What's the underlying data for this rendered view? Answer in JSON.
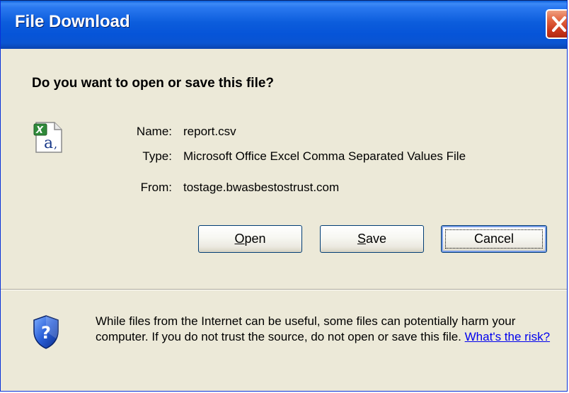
{
  "window": {
    "title": "File Download"
  },
  "dialog": {
    "question": "Do you want to open or save this file?",
    "file": {
      "name_label": "Name:",
      "name_value": "report.csv",
      "type_label": "Type:",
      "type_value": "Microsoft Office Excel Comma Separated Values File",
      "from_label": "From:",
      "from_value": "tostage.bwasbestostrust.com",
      "icon": "excel-csv-file-icon"
    },
    "buttons": {
      "open_mnemonic": "O",
      "open_rest": "pen",
      "save_mnemonic": "S",
      "save_rest": "ave",
      "cancel_label": "Cancel"
    }
  },
  "warning": {
    "icon": "shield-question-icon",
    "text": "While files from the Internet can be useful, some files can potentially harm your computer. If you do not trust the source, do not open or save this file.",
    "link_text": "What's the risk?"
  },
  "colors": {
    "titlebar": "#0a5fdc",
    "dialog_bg": "#ece9d8",
    "close_button": "#e26440",
    "link": "#0000ee"
  }
}
